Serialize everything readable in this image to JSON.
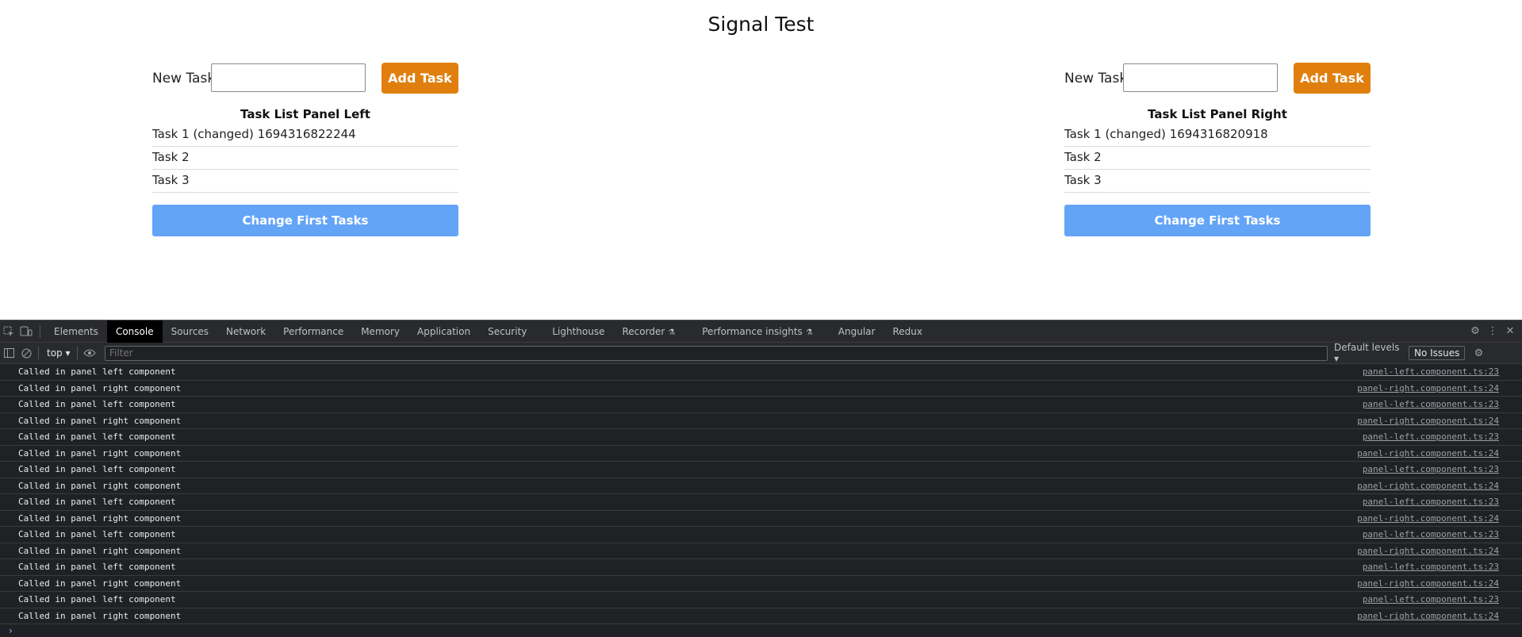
{
  "app": {
    "title": "Signal Test",
    "panels": [
      {
        "form_label": "New Task",
        "input_value": "",
        "add_button": "Add Task",
        "title": "Task List Panel Left",
        "tasks": [
          "Task 1 (changed) 1694316822244",
          "Task 2",
          "Task 3"
        ],
        "change_button": "Change First Tasks"
      },
      {
        "form_label": "New Task",
        "input_value": "",
        "add_button": "Add Task",
        "title": "Task List Panel Right",
        "tasks": [
          "Task 1 (changed) 1694316820918",
          "Task 2",
          "Task 3"
        ],
        "change_button": "Change First Tasks"
      }
    ],
    "colors": {
      "add_button": "#e07f0e",
      "change_button": "#63a4f7"
    }
  },
  "devtools": {
    "tabs": [
      "Elements",
      "Console",
      "Sources",
      "Network",
      "Performance",
      "Memory",
      "Application",
      "Security",
      "Lighthouse",
      "Recorder",
      "Performance insights",
      "Angular",
      "Redux"
    ],
    "active_tab": "Console",
    "context": "top",
    "filter_placeholder": "Filter",
    "levels": "Default levels",
    "issues": "No Issues",
    "logs": [
      {
        "message": "Called in panel left component",
        "source": "panel-left.component.ts:23"
      },
      {
        "message": "Called in panel right component",
        "source": "panel-right.component.ts:24"
      },
      {
        "message": "Called in panel left component",
        "source": "panel-left.component.ts:23"
      },
      {
        "message": "Called in panel right component",
        "source": "panel-right.component.ts:24"
      },
      {
        "message": "Called in panel left component",
        "source": "panel-left.component.ts:23"
      },
      {
        "message": "Called in panel right component",
        "source": "panel-right.component.ts:24"
      },
      {
        "message": "Called in panel left component",
        "source": "panel-left.component.ts:23"
      },
      {
        "message": "Called in panel right component",
        "source": "panel-right.component.ts:24"
      },
      {
        "message": "Called in panel left component",
        "source": "panel-left.component.ts:23"
      },
      {
        "message": "Called in panel right component",
        "source": "panel-right.component.ts:24"
      },
      {
        "message": "Called in panel left component",
        "source": "panel-left.component.ts:23"
      },
      {
        "message": "Called in panel right component",
        "source": "panel-right.component.ts:24"
      },
      {
        "message": "Called in panel left component",
        "source": "panel-left.component.ts:23"
      },
      {
        "message": "Called in panel right component",
        "source": "panel-right.component.ts:24"
      },
      {
        "message": "Called in panel left component",
        "source": "panel-left.component.ts:23"
      },
      {
        "message": "Called in panel right component",
        "source": "panel-right.component.ts:24"
      }
    ],
    "prompt": "›"
  }
}
